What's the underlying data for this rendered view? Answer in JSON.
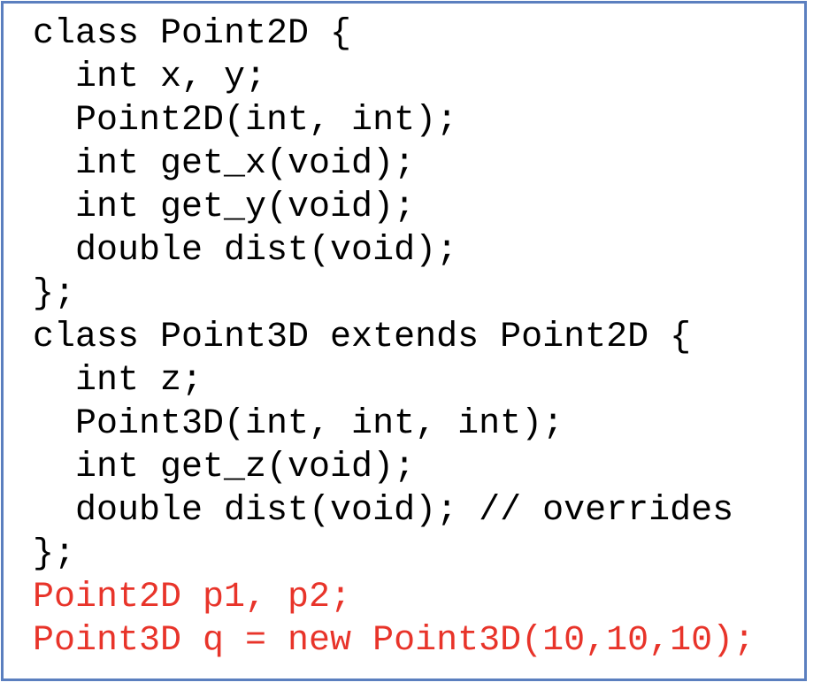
{
  "code": {
    "lines": [
      {
        "text": "class Point2D {",
        "color": "#000000"
      },
      {
        "text": "  int x, y;",
        "color": "#000000"
      },
      {
        "text": "  Point2D(int, int);",
        "color": "#000000"
      },
      {
        "text": "  int get_x(void);",
        "color": "#000000"
      },
      {
        "text": "  int get_y(void);",
        "color": "#000000"
      },
      {
        "text": "  double dist(void);",
        "color": "#000000"
      },
      {
        "text": "};",
        "color": "#000000"
      },
      {
        "text": "class Point3D extends Point2D {",
        "color": "#000000"
      },
      {
        "text": "  int z;",
        "color": "#000000"
      },
      {
        "text": "  Point3D(int, int, int);",
        "color": "#000000"
      },
      {
        "text": "  int get_z(void);",
        "color": "#000000"
      },
      {
        "text": "  double dist(void); // overrides",
        "color": "#000000"
      },
      {
        "text": "};",
        "color": "#000000"
      },
      {
        "text": "Point2D p1, p2;",
        "color": "#e8342a"
      },
      {
        "text": "Point3D q = new Point3D(10,10,10);",
        "color": "#e8342a"
      }
    ]
  },
  "colors": {
    "border": "#5b7fbf",
    "highlight": "#e8342a",
    "text": "#000000"
  }
}
